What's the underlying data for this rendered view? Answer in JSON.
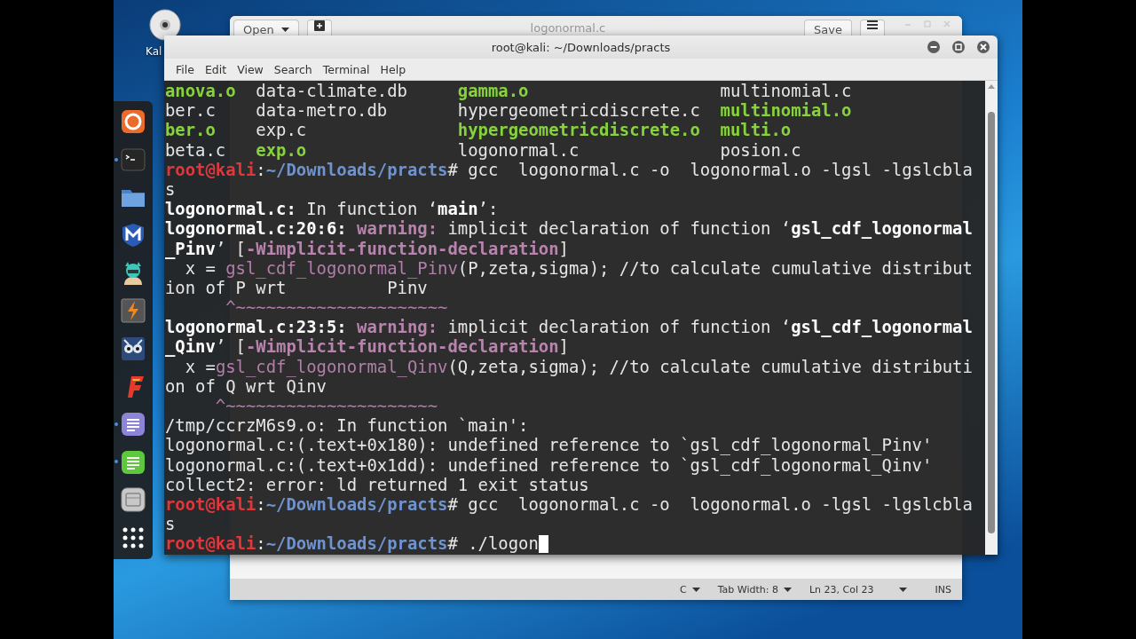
{
  "desktop": {
    "icon_label": "Kal"
  },
  "dock": {
    "items": [
      {
        "kind": "swirl",
        "running": false
      },
      {
        "kind": "terminal",
        "running": true
      },
      {
        "kind": "folder",
        "running": false
      },
      {
        "kind": "shield",
        "running": false
      },
      {
        "kind": "character",
        "running": false
      },
      {
        "kind": "lightning",
        "running": false
      },
      {
        "kind": "owl",
        "running": false
      },
      {
        "kind": "flame",
        "running": false
      },
      {
        "kind": "notes-purple",
        "running": true
      },
      {
        "kind": "notes-green",
        "running": true
      },
      {
        "kind": "device",
        "running": false
      },
      {
        "kind": "grid",
        "running": false
      }
    ]
  },
  "editor": {
    "open_button": "Open",
    "title": "logonormal.c",
    "save_button": "Save",
    "status_bar": {
      "language": "C",
      "tab_width": "Tab Width: 8",
      "position": "Ln 23, Col 23",
      "mode": "INS"
    }
  },
  "terminal": {
    "title": "root@kali: ~/Downloads/practs",
    "menu": [
      "File",
      "Edit",
      "View",
      "Search",
      "Terminal",
      "Help"
    ],
    "cursor": true,
    "lines": [
      [
        {
          "kind": "exec",
          "text": "anova.o"
        },
        {
          "kind": "plain",
          "text": "  data-climate.db     "
        },
        {
          "kind": "exec",
          "text": "gamma.o"
        },
        {
          "kind": "plain",
          "text": "                   multinomial.c"
        }
      ],
      [
        {
          "kind": "plain",
          "text": "ber.c    data-metro.db       hypergeometricdiscrete.c  "
        },
        {
          "kind": "exec",
          "text": "multinomial.o"
        }
      ],
      [
        {
          "kind": "exec",
          "text": "ber.o"
        },
        {
          "kind": "plain",
          "text": "    exp.c               "
        },
        {
          "kind": "exec",
          "text": "hypergeometricdiscrete.o"
        },
        {
          "kind": "exec",
          "text": "  multi.o"
        }
      ],
      [
        {
          "kind": "plain",
          "text": "beta.c   "
        },
        {
          "kind": "exec",
          "text": "exp.o"
        },
        {
          "kind": "plain",
          "text": "               logonormal.c              posion.c"
        }
      ],
      [
        {
          "kind": "user",
          "text": "root@kali"
        },
        {
          "kind": "plain",
          "text": ":"
        },
        {
          "kind": "path",
          "text": "~/Downloads/practs"
        },
        {
          "kind": "plain",
          "text": "# gcc  logonormal.c -o  logonormal.o -lgsl -lgslcbla"
        }
      ],
      [
        {
          "kind": "plain",
          "text": "s"
        }
      ],
      [
        {
          "kind": "bold",
          "text": "logonormal.c:"
        },
        {
          "kind": "plain",
          "text": " In function ‘"
        },
        {
          "kind": "bold",
          "text": "main"
        },
        {
          "kind": "plain",
          "text": "’:"
        }
      ],
      [
        {
          "kind": "bold",
          "text": "logonormal.c:20:6:"
        },
        {
          "kind": "warn",
          "text": " warning:"
        },
        {
          "kind": "plain",
          "text": " implicit declaration of function ‘"
        },
        {
          "kind": "bold",
          "text": "gsl_cdf_logonormal"
        }
      ],
      [
        {
          "kind": "bold",
          "text": "_Pinv"
        },
        {
          "kind": "plain",
          "text": "’ ["
        },
        {
          "kind": "warn",
          "text": "-Wimplicit-function-declaration"
        },
        {
          "kind": "plain",
          "text": "]"
        }
      ],
      [
        {
          "kind": "plain",
          "text": "  x = "
        },
        {
          "kind": "fn",
          "text": "gsl_cdf_logonormal_Pinv"
        },
        {
          "kind": "plain",
          "text": "(P,zeta,sigma); //to calculate cumulative distribut"
        }
      ],
      [
        {
          "kind": "plain",
          "text": "ion of P wrt          Pinv"
        }
      ],
      [
        {
          "kind": "fn",
          "text": "      ^~~~~~~~~~~~~~~~~~~~~~"
        }
      ],
      [
        {
          "kind": "bold",
          "text": "logonormal.c:23:5:"
        },
        {
          "kind": "warn",
          "text": " warning:"
        },
        {
          "kind": "plain",
          "text": " implicit declaration of function ‘"
        },
        {
          "kind": "bold",
          "text": "gsl_cdf_logonormal"
        }
      ],
      [
        {
          "kind": "bold",
          "text": "_Qinv"
        },
        {
          "kind": "plain",
          "text": "’ ["
        },
        {
          "kind": "warn",
          "text": "-Wimplicit-function-declaration"
        },
        {
          "kind": "plain",
          "text": "]"
        }
      ],
      [
        {
          "kind": "plain",
          "text": "  x ="
        },
        {
          "kind": "fn",
          "text": "gsl_cdf_logonormal_Qinv"
        },
        {
          "kind": "plain",
          "text": "(Q,zeta,sigma); //to calculate cumulative distributi"
        }
      ],
      [
        {
          "kind": "plain",
          "text": "on of Q wrt Qinv"
        }
      ],
      [
        {
          "kind": "fn",
          "text": "     ^~~~~~~~~~~~~~~~~~~~~~"
        }
      ],
      [
        {
          "kind": "plain",
          "text": "/tmp/ccrzM6s9.o: In function `main':"
        }
      ],
      [
        {
          "kind": "plain",
          "text": "logonormal.c:(.text+0x180): undefined reference to `gsl_cdf_logonormal_Pinv'"
        }
      ],
      [
        {
          "kind": "plain",
          "text": "logonormal.c:(.text+0x1dd): undefined reference to `gsl_cdf_logonormal_Qinv'"
        }
      ],
      [
        {
          "kind": "plain",
          "text": "collect2: error: ld returned 1 exit status"
        }
      ],
      [
        {
          "kind": "user",
          "text": "root@kali"
        },
        {
          "kind": "plain",
          "text": ":"
        },
        {
          "kind": "path",
          "text": "~/Downloads/practs"
        },
        {
          "kind": "plain",
          "text": "# gcc  logonormal.c -o  logonormal.o -lgsl -lgslcbla"
        }
      ],
      [
        {
          "kind": "plain",
          "text": "s"
        }
      ],
      [
        {
          "kind": "user",
          "text": "root@kali"
        },
        {
          "kind": "plain",
          "text": ":"
        },
        {
          "kind": "path",
          "text": "~/Downloads/practs"
        },
        {
          "kind": "plain",
          "text": "# ./logon"
        }
      ]
    ]
  }
}
